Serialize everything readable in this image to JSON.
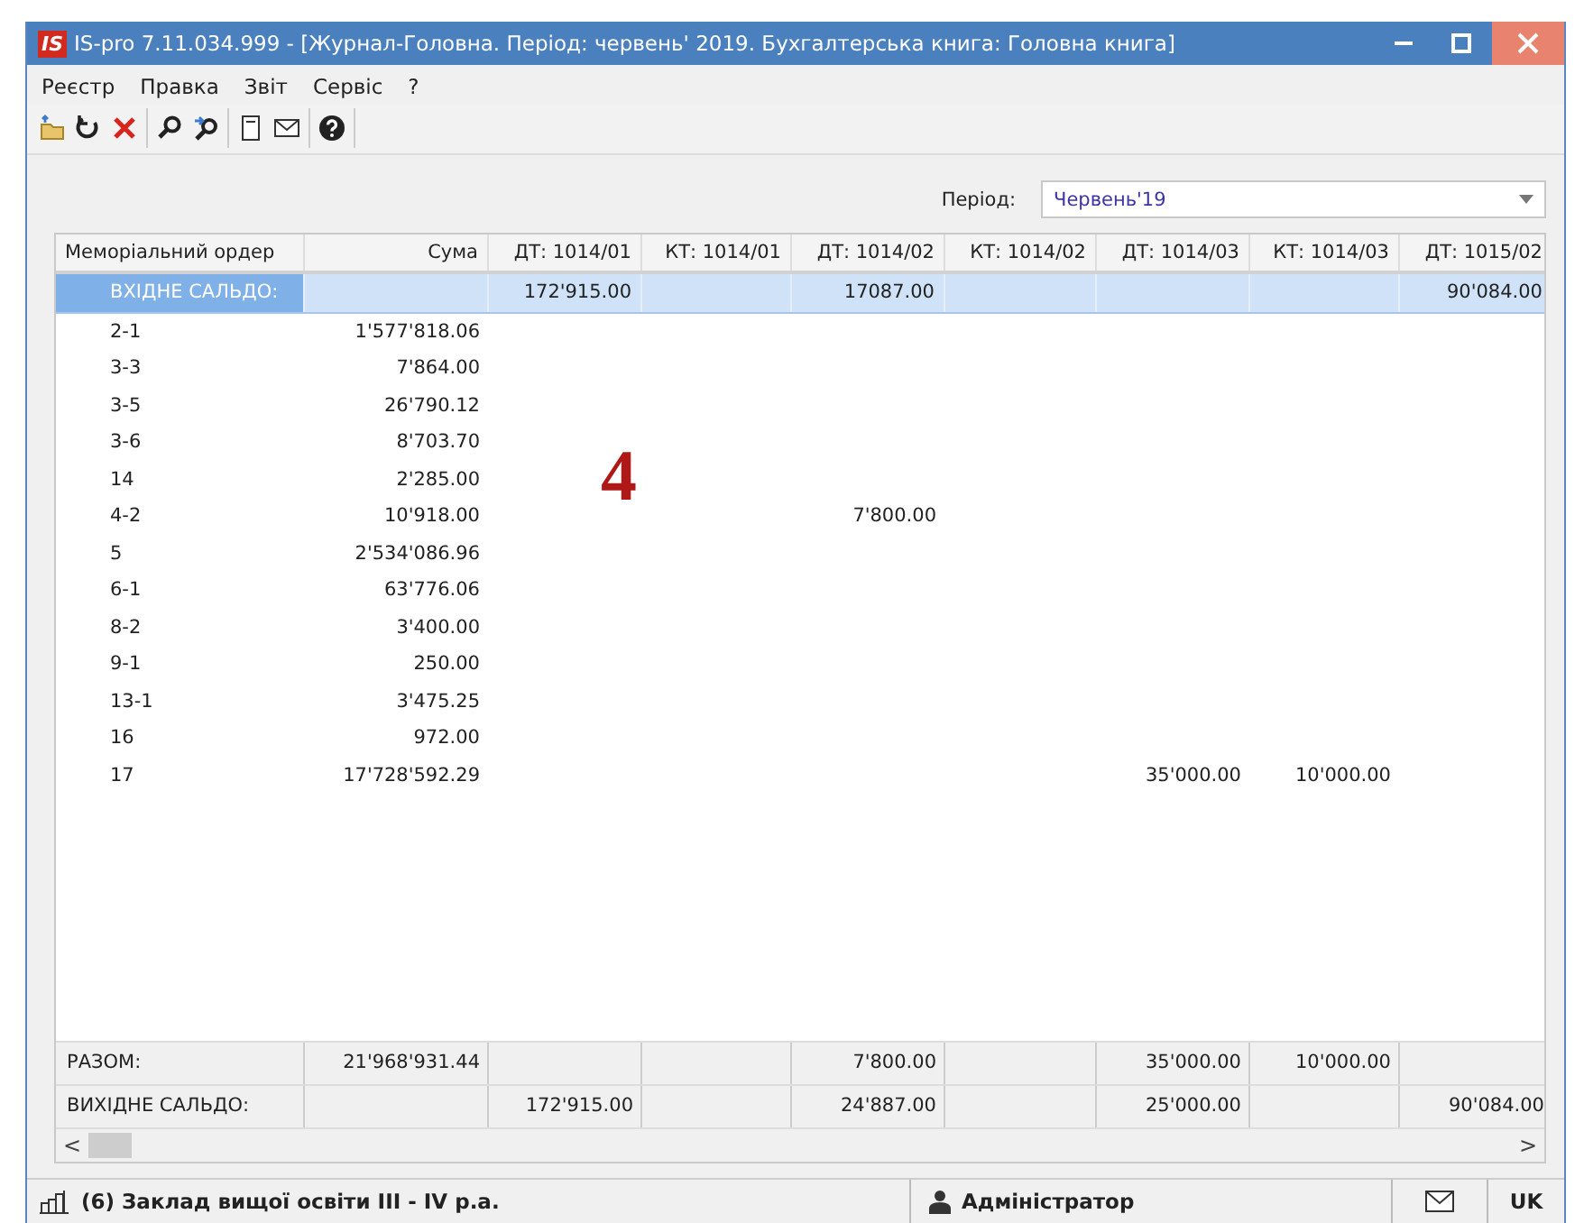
{
  "window": {
    "logo": "IS",
    "title": "IS-pro 7.11.034.999 - [Журнал-Головна. Період: червень' 2019. Бухгалтерська книга: Головна книга]"
  },
  "menu": [
    "Реєстр",
    "Правка",
    "Звіт",
    "Сервіс",
    "?"
  ],
  "toolbar": [
    {
      "kind": "folder"
    },
    {
      "kind": "refresh"
    },
    {
      "kind": "delete"
    },
    {
      "kind": "search"
    },
    {
      "kind": "search-next"
    },
    {
      "kind": "document"
    },
    {
      "kind": "mail"
    },
    {
      "kind": "help"
    }
  ],
  "period": {
    "label": "Період:",
    "value": "Червень'19"
  },
  "table": {
    "columns": [
      "Меморіальний ордер",
      "Сума",
      "ДТ: 1014/01",
      "КТ: 1014/01",
      "ДТ: 1014/02",
      "КТ: 1014/02",
      "ДТ: 1014/03",
      "КТ: 1014/03",
      "ДТ: 1015/02"
    ],
    "rows": [
      {
        "selected": true,
        "cells": [
          "ВХІДНЕ САЛЬДО:",
          null,
          "172'915.00",
          null,
          "17087.00",
          null,
          null,
          null,
          "90'084.00"
        ]
      },
      {
        "selected": false,
        "cells": [
          "2-1",
          "1'577'818.06",
          null,
          null,
          null,
          null,
          null,
          null,
          null
        ]
      },
      {
        "selected": false,
        "cells": [
          "3-3",
          "7'864.00",
          null,
          null,
          null,
          null,
          null,
          null,
          null
        ]
      },
      {
        "selected": false,
        "cells": [
          "3-5",
          "26'790.12",
          null,
          null,
          null,
          null,
          null,
          null,
          null
        ]
      },
      {
        "selected": false,
        "cells": [
          "3-6",
          "8'703.70",
          null,
          null,
          null,
          null,
          null,
          null,
          null
        ]
      },
      {
        "selected": false,
        "cells": [
          "14",
          "2'285.00",
          null,
          null,
          null,
          null,
          null,
          null,
          null
        ]
      },
      {
        "selected": false,
        "cells": [
          "4-2",
          "10'918.00",
          null,
          null,
          "7'800.00",
          null,
          null,
          null,
          null
        ]
      },
      {
        "selected": false,
        "cells": [
          "5",
          "2'534'086.96",
          null,
          null,
          null,
          null,
          null,
          null,
          null
        ]
      },
      {
        "selected": false,
        "cells": [
          "6-1",
          "63'776.06",
          null,
          null,
          null,
          null,
          null,
          null,
          null
        ]
      },
      {
        "selected": false,
        "cells": [
          "8-2",
          "3'400.00",
          null,
          null,
          null,
          null,
          null,
          null,
          null
        ]
      },
      {
        "selected": false,
        "cells": [
          "9-1",
          "250.00",
          null,
          null,
          null,
          null,
          null,
          null,
          null
        ]
      },
      {
        "selected": false,
        "cells": [
          "13-1",
          "3'475.25",
          null,
          null,
          null,
          null,
          null,
          null,
          null
        ]
      },
      {
        "selected": false,
        "cells": [
          "16",
          "972.00",
          null,
          null,
          null,
          null,
          null,
          null,
          null
        ]
      },
      {
        "selected": false,
        "cells": [
          "17",
          "17'728'592.29",
          null,
          null,
          null,
          null,
          "35'000.00",
          "10'000.00",
          null
        ]
      }
    ],
    "footer_rows": [
      {
        "cells": [
          "РАЗОМ:",
          "21'968'931.44",
          null,
          null,
          "7'800.00",
          null,
          "35'000.00",
          "10'000.00",
          null
        ]
      },
      {
        "cells": [
          "ВИХІДНЕ САЛЬДО:",
          null,
          "172'915.00",
          null,
          "24'887.00",
          null,
          "25'000.00",
          null,
          "90'084.00"
        ]
      }
    ]
  },
  "scrollbar": {
    "left": "<",
    "right": ">"
  },
  "annotation": "4",
  "status_bar": {
    "organization": "(6) Заклад вищої освіти III - IV р.а.",
    "user": "Адміністратор",
    "language": "UK"
  }
}
